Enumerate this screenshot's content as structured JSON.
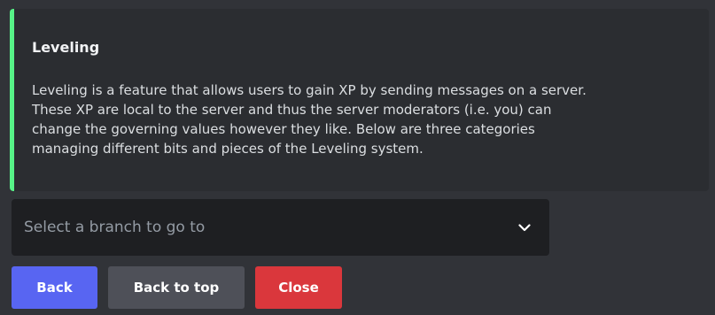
{
  "embed": {
    "accent_color": "#57f287",
    "title": "Leveling",
    "description_lines": [
      "Leveling is a feature that allows users to gain XP by sending messages on a server.",
      "These XP are local to the server and thus the server moderators (i.e. you) can",
      "change the governing values however they like. Below are three categories",
      "managing different bits and pieces of the Leveling system."
    ]
  },
  "select": {
    "placeholder": "Select a branch to go to",
    "icon": "chevron-down-icon"
  },
  "buttons": {
    "back": {
      "label": "Back",
      "color": "#5865f2"
    },
    "back_to_top": {
      "label": "Back to top",
      "color": "#4e5058"
    },
    "close": {
      "label": "Close",
      "color": "#da373c"
    }
  }
}
